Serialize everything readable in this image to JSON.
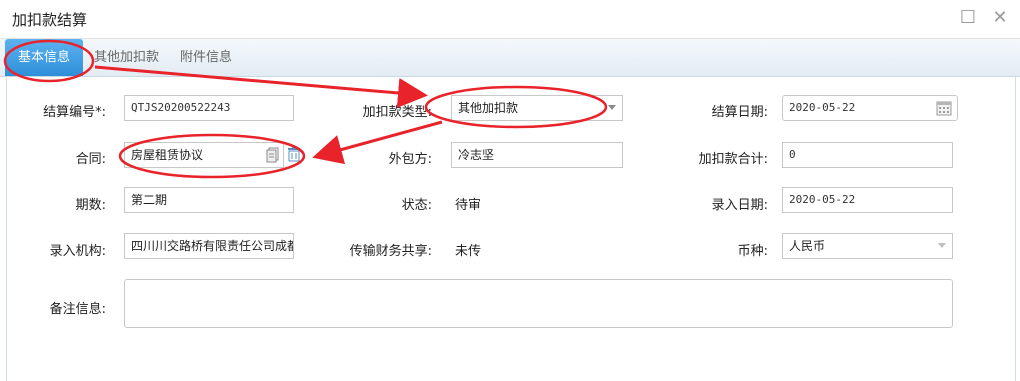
{
  "window": {
    "title": "加扣款结算"
  },
  "tabs": [
    {
      "label": "基本信息",
      "active": true
    },
    {
      "label": "其他加扣款",
      "active": false
    },
    {
      "label": "附件信息",
      "active": false
    }
  ],
  "form": {
    "settle_no": {
      "label": "结算编号*:",
      "value": "QTJS20200522243"
    },
    "deduct_type": {
      "label": "加扣款类型:",
      "value": "其他加扣款"
    },
    "settle_date": {
      "label": "结算日期:",
      "value": "2020-05-22"
    },
    "contract": {
      "label": "合同:",
      "value": "房屋租赁协议"
    },
    "subcontractor": {
      "label": "外包方:",
      "value": "冷志坚"
    },
    "deduct_total": {
      "label": "加扣款合计:",
      "value": "0"
    },
    "period": {
      "label": "期数:",
      "value": "第二期"
    },
    "status": {
      "label": "状态:",
      "value": "待审"
    },
    "entry_date": {
      "label": "录入日期:",
      "value": "2020-05-22"
    },
    "entry_org": {
      "label": "录入机构:",
      "value": "四川川交路桥有限责任公司成都"
    },
    "finance_share": {
      "label": "传输财务共享:",
      "value": "未传"
    },
    "currency": {
      "label": "币种:",
      "value": "人民币"
    },
    "remarks": {
      "label": "备注信息:",
      "value": ""
    }
  },
  "colors": {
    "annotation": "#e8232a",
    "tab_active": "#2e8fd9"
  },
  "icons": {
    "maximize": "maximize-icon",
    "close": "close-icon",
    "calendar": "calendar-icon",
    "copy": "copy-icon",
    "delete": "trash-icon"
  }
}
